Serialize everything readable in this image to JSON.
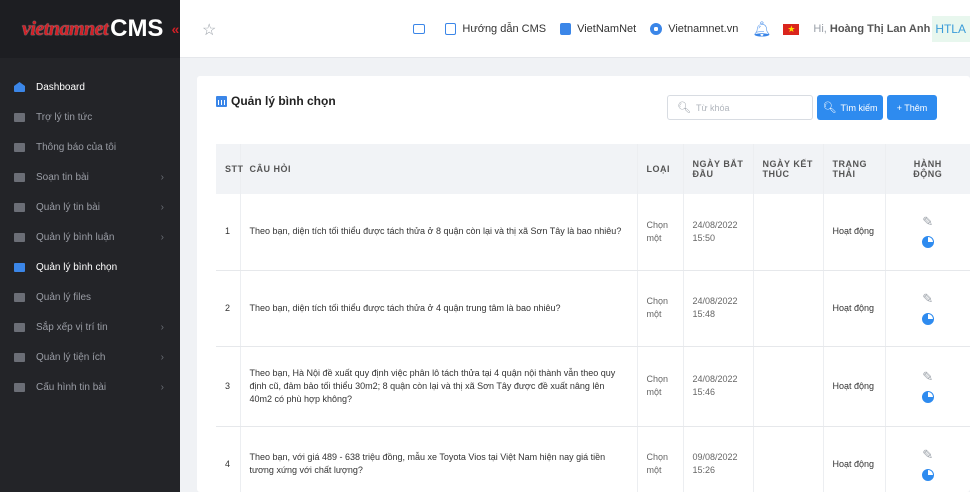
{
  "sidebar": {
    "logo_text": "vietnamnet",
    "logo_cms": "CMS",
    "collapse_icon": "«",
    "items": [
      {
        "label": "Dashboard",
        "icon": "home-icon",
        "active": true,
        "chevron": false
      },
      {
        "label": "Trợ lý tin tức",
        "icon": "doc-icon",
        "active": false,
        "chevron": false
      },
      {
        "label": "Thông báo của tôi",
        "icon": "bell-icon",
        "active": false,
        "chevron": false
      },
      {
        "label": "Soạn tin bài",
        "icon": "edit-icon",
        "active": false,
        "chevron": true
      },
      {
        "label": "Quản lý tin bài",
        "icon": "list-icon",
        "active": false,
        "chevron": true
      },
      {
        "label": "Quản lý bình luận",
        "icon": "comment-icon",
        "active": false,
        "chevron": true
      },
      {
        "label": "Quản lý bình chọn",
        "icon": "poll-icon",
        "active": true,
        "chevron": false
      },
      {
        "label": "Quản lý files",
        "icon": "file-icon",
        "active": false,
        "chevron": false
      },
      {
        "label": "Sắp xếp vị trí tin",
        "icon": "sort-icon",
        "active": false,
        "chevron": true
      },
      {
        "label": "Quản lý tiện ích",
        "icon": "widget-icon",
        "active": false,
        "chevron": true
      },
      {
        "label": "Cấu hình tin bài",
        "icon": "config-icon",
        "active": false,
        "chevron": true
      }
    ]
  },
  "topbar": {
    "guide": "Hướng dẫn CMS",
    "vnn": "VietNamNet",
    "site": "Vietnamnet.vn",
    "greeting": "Hi,",
    "user": "Hoàng Thị Lan Anh",
    "user_short": "HTLA"
  },
  "page": {
    "title": "Quản lý bình chọn",
    "search_placeholder": "Từ khóa",
    "search_button": "Tìm kiếm",
    "add_button": "+ Thêm"
  },
  "table": {
    "headers": {
      "stt": "STT",
      "question": "CÂU HỎI",
      "type": "LOẠI",
      "start_1": "NGÀY BẮT",
      "start_2": "ĐẦU",
      "end_1": "NGÀY KẾT",
      "end_2": "THÚC",
      "status_1": "TRẠNG",
      "status_2": "THÁI",
      "action_1": "HÀNH",
      "action_2": "ĐỘNG"
    },
    "rows": [
      {
        "stt": "1",
        "question": "Theo bạn, diện tích tối thiểu được tách thửa ở 8 quận còn lại và thị xã Sơn Tây là bao nhiêu?",
        "type_1": "Chọn",
        "type_2": "một",
        "date": "24/08/2022",
        "time": "15:50",
        "end": "",
        "status": "Hoạt động"
      },
      {
        "stt": "2",
        "question": "Theo bạn, diện tích tối thiểu được tách thửa ở 4 quận trung tâm là bao nhiêu?",
        "type_1": "Chọn",
        "type_2": "một",
        "date": "24/08/2022",
        "time": "15:48",
        "end": "",
        "status": "Hoạt động"
      },
      {
        "stt": "3",
        "question": "Theo bạn, Hà Nội đề xuất quy định việc phân lô tách thửa tại 4 quận nội thành vẫn theo quy định cũ, đảm bảo tối thiểu 30m2; 8 quận còn lại và thị xã Sơn Tây được đề xuất nâng lên 40m2 có phù hợp không?",
        "type_1": "Chọn",
        "type_2": "một",
        "date": "24/08/2022",
        "time": "15:46",
        "end": "",
        "status": "Hoạt động"
      },
      {
        "stt": "4",
        "question": "Theo bạn, với giá 489 - 638 triệu đồng, mẫu xe Toyota Vios tại Việt Nam hiện nay giá tiền tương xứng với chất lượng?",
        "type_1": "Chọn",
        "type_2": "một",
        "date": "09/08/2022",
        "time": "15:26",
        "end": "",
        "status": "Hoạt động"
      }
    ]
  },
  "colors": {
    "accent": "#2e8bef",
    "sidebar": "#232428",
    "brand_red": "#d11f26"
  }
}
